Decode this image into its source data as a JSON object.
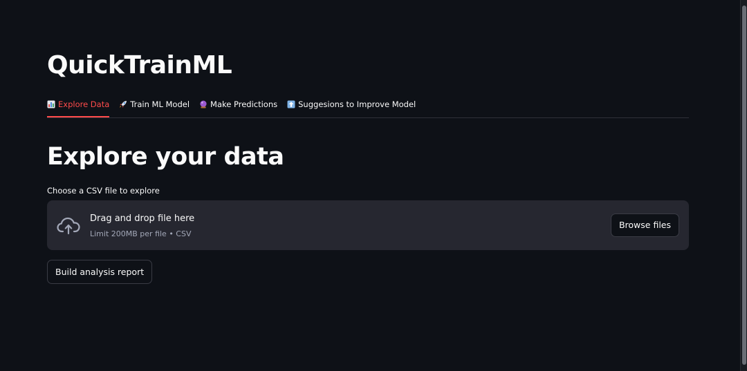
{
  "app": {
    "title": "QuickTrainML"
  },
  "tabs": [
    {
      "label": "Explore Data",
      "icon": "bar-chart-icon",
      "active": true
    },
    {
      "label": "Train ML Model",
      "icon": "rocket-icon",
      "active": false
    },
    {
      "label": "Make Predictions",
      "icon": "crystal-ball-icon",
      "active": false
    },
    {
      "label": "Suggesions to Improve Model",
      "icon": "up-arrow-icon",
      "active": false
    }
  ],
  "page": {
    "heading": "Explore your data"
  },
  "uploader": {
    "label": "Choose a CSV file to explore",
    "drop_title": "Drag and drop file here",
    "drop_subtitle": "Limit 200MB per file • CSV",
    "browse_label": "Browse files",
    "icon": "cloud-upload-icon"
  },
  "actions": {
    "build_label": "Build analysis report"
  },
  "colors": {
    "background": "#0e1117",
    "accent": "#ff4b4b",
    "surface": "#262730",
    "text": "#fafafa",
    "muted": "#a3a8b8"
  }
}
